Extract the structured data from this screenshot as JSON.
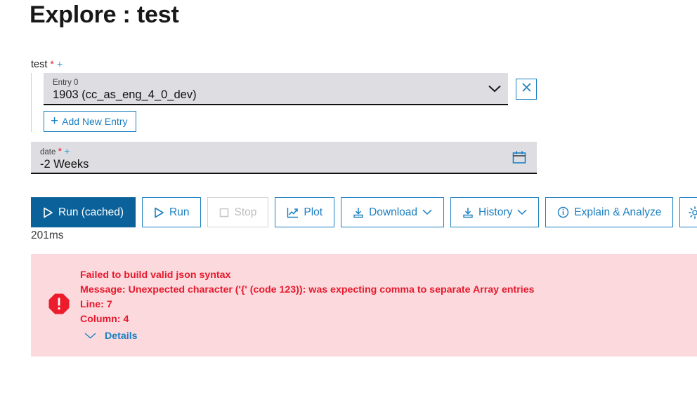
{
  "page": {
    "title": "Explore : test"
  },
  "test_field": {
    "label": "test",
    "required_mark": "*",
    "add_mark": "+",
    "entry": {
      "label": "Entry 0",
      "value": "1903 (cc_as_eng_4_0_dev)"
    },
    "dropdown_icon": "chevron-down-icon",
    "remove_icon": "close-icon",
    "add_new_entry_label": "Add New Entry",
    "add_new_entry_plus": "+"
  },
  "date_field": {
    "label": "date",
    "required_mark": "*",
    "add_mark": "+",
    "value": "-2 Weeks",
    "calendar_icon": "calendar-icon"
  },
  "toolbar": {
    "run_cached_label": "Run (cached)",
    "run_label": "Run",
    "stop_label": "Stop",
    "plot_label": "Plot",
    "download_label": "Download",
    "history_label": "History",
    "explain_label": "Explain & Analyze",
    "settings_icon": "gear-icon"
  },
  "status": {
    "timing": "201ms"
  },
  "error": {
    "icon": "error-octagon-icon",
    "title": "Failed to build valid json syntax",
    "message": "Message: Unexpected character ('{' (code 123)): was expecting comma to separate Array entries",
    "line": "Line: 7",
    "column": "Column: 4",
    "details_label": "Details",
    "details_chevron": "chevron-down-icon"
  },
  "colors": {
    "primary_blue": "#0b6199",
    "link_blue": "#1b7fc0",
    "error_red": "#e8192c",
    "error_bg": "#fbd9dd",
    "field_bg": "#dedee2"
  }
}
